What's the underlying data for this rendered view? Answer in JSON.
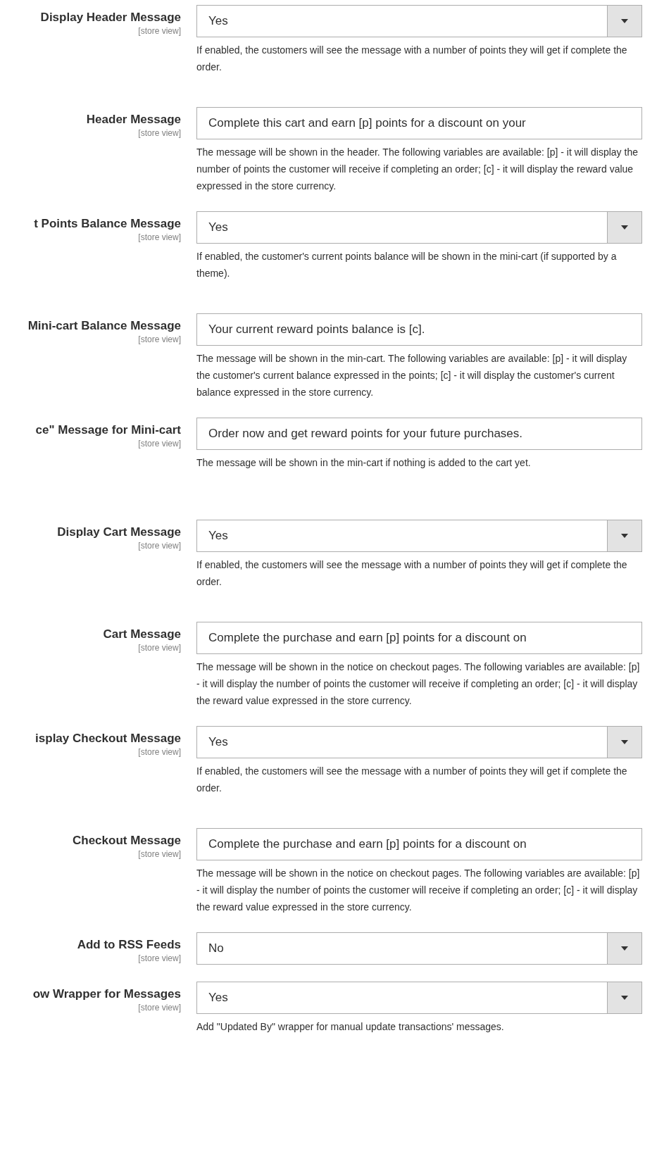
{
  "fields": [
    {
      "label": "Display Header Message",
      "scope": "[store view]",
      "kind": "select",
      "value": "Yes",
      "note": "If enabled, the customers will see the message with a number of points they will get if complete the order."
    },
    {
      "label": "Header Message",
      "scope": "[store view]",
      "kind": "text",
      "value": "Complete this cart and earn [p] points for a discount on your",
      "note": "The message will be shown in the header. The following variables are available: [p] - it will display the number of points the customer will receive if completing an order; [c] - it will display the reward value expressed in the store currency."
    },
    {
      "label": "t Points Balance Message",
      "scope": "[store view]",
      "kind": "select",
      "value": "Yes",
      "note": "If enabled, the customer's current points balance will be shown in the mini-cart (if supported by a theme)."
    },
    {
      "label": "Mini-cart Balance Message",
      "scope": "[store view]",
      "kind": "text",
      "value": "Your current reward points balance is [c].",
      "note": "The message will be shown in the min-cart. The following variables are available: [p] - it will display the customer's current balance expressed in the points; [c] - it will display the customer's current balance expressed in the store currency."
    },
    {
      "label": "ce\" Message for Mini-cart",
      "scope": "[store view]",
      "kind": "text",
      "value": "Order now and get reward points for your future purchases.",
      "note": "The message will be shown in the min-cart if nothing is added to the cart yet."
    },
    {
      "label": "Display Cart Message",
      "scope": "[store view]",
      "kind": "select",
      "value": "Yes",
      "note": "If enabled, the customers will see the message with a number of points they will get if complete the order."
    },
    {
      "label": "Cart Message",
      "scope": "[store view]",
      "kind": "text",
      "value": "Complete the purchase and earn [p] points for a discount on",
      "note": "The message will be shown in the notice on checkout pages. The following variables are available: [p] - it will display the number of points the customer will receive if completing an order; [c] - it will display the reward value expressed in the store currency."
    },
    {
      "label": "isplay Checkout Message",
      "scope": "[store view]",
      "kind": "select",
      "value": "Yes",
      "note": "If enabled, the customers will see the message with a number of points they will get if complete the order."
    },
    {
      "label": "Checkout Message",
      "scope": "[store view]",
      "kind": "text",
      "value": "Complete the purchase and earn [p] points for a discount on",
      "note": "The message will be shown in the notice on checkout pages. The following variables are available: [p] - it will display the number of points the customer will receive if completing an order; [c] - it will display the reward value expressed in the store currency."
    },
    {
      "label": "Add to RSS Feeds",
      "scope": "[store view]",
      "kind": "select",
      "value": "No"
    },
    {
      "label": "ow Wrapper for Messages",
      "scope": "[store view]",
      "kind": "select",
      "value": "Yes",
      "note": "Add \"Updated By\" wrapper for manual update transactions' messages."
    }
  ]
}
